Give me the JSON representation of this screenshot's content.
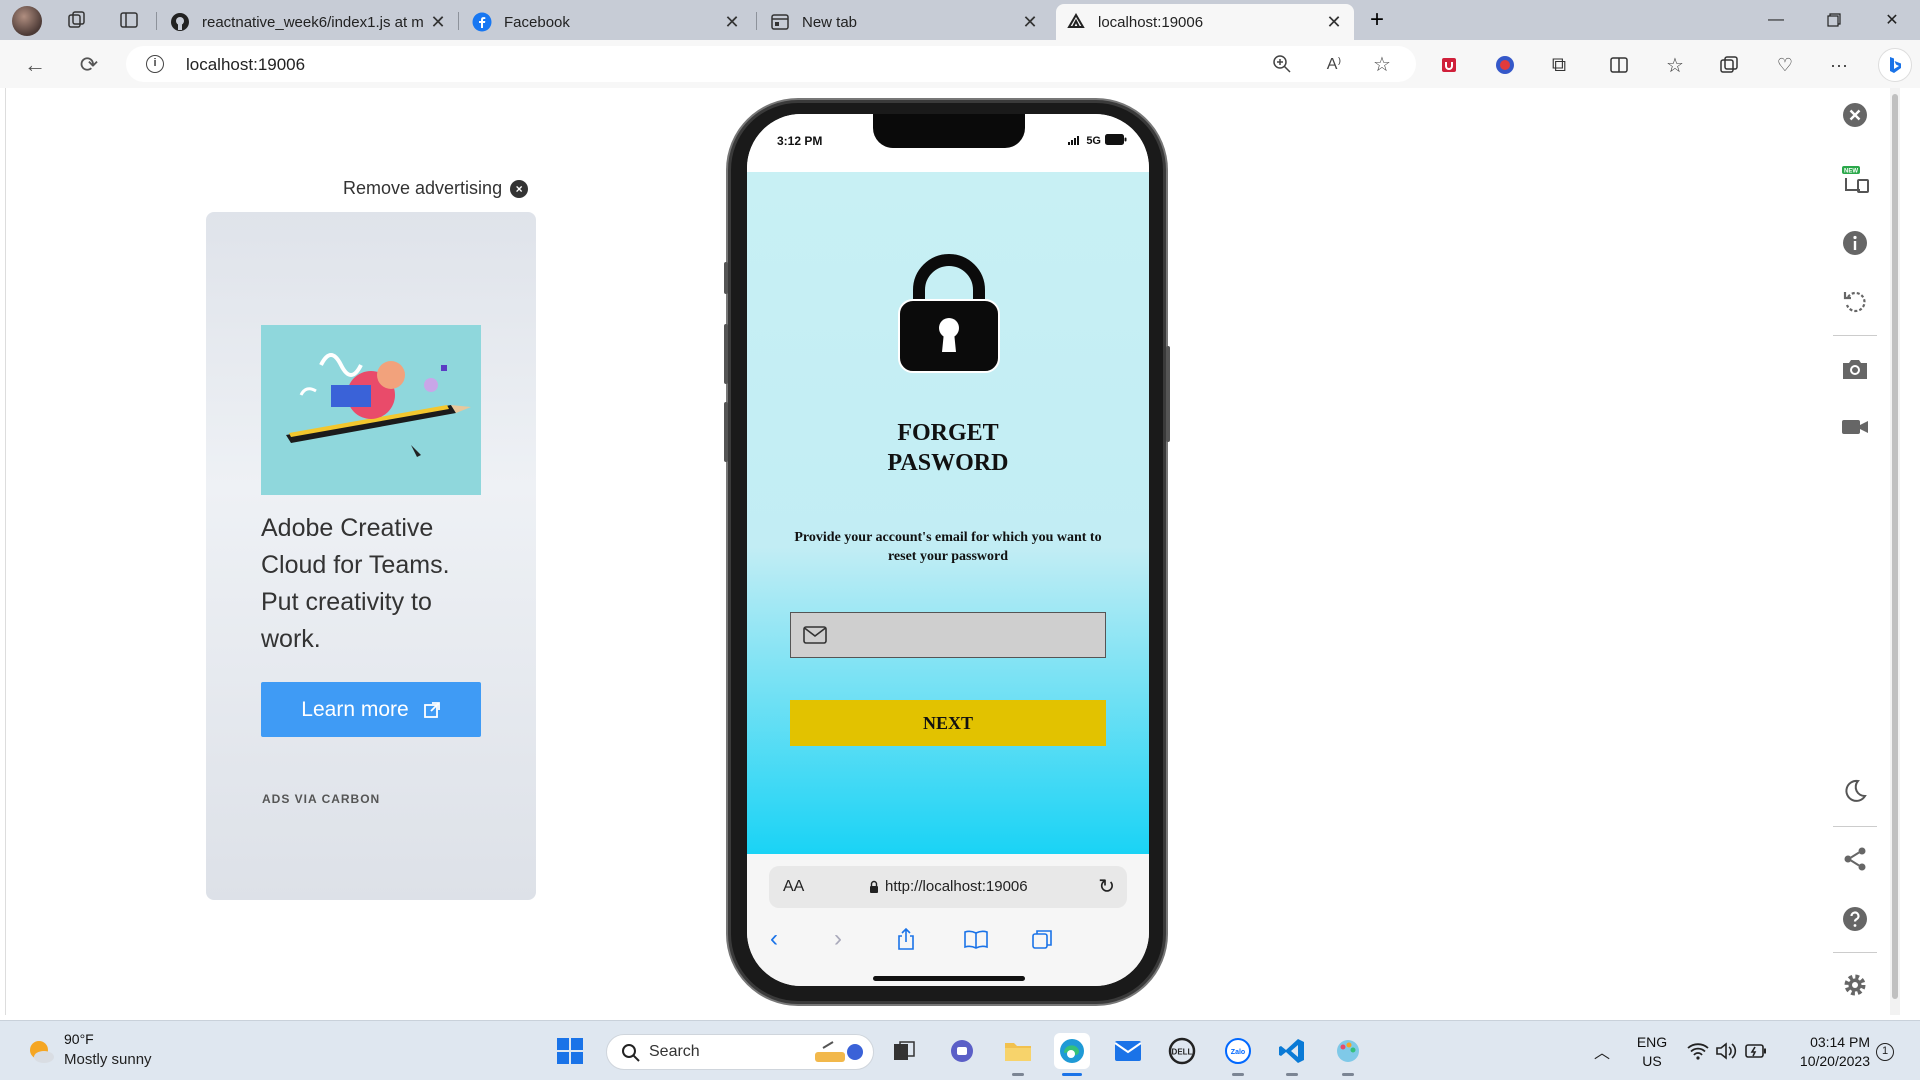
{
  "browser": {
    "tabs": [
      {
        "title": "reactnative_week6/index1.js at m",
        "icon": "github-icon"
      },
      {
        "title": "Facebook",
        "icon": "facebook-icon"
      },
      {
        "title": "New tab",
        "icon": "newtab-icon"
      },
      {
        "title": "localhost:19006",
        "icon": "expo-icon",
        "active": true
      }
    ],
    "address": "localhost:19006"
  },
  "ad": {
    "remove_label": "Remove advertising",
    "text": "Adobe Creative Cloud for Teams. Put creativity to work.",
    "button_label": "Learn more",
    "via_label": "ADS VIA CARBON"
  },
  "phone": {
    "status_time": "3:12 PM",
    "network": "5G",
    "title_line1": "FORGET",
    "title_line2": "PASWORD",
    "description": "Provide your account's email for which you want to reset your password",
    "email_value": "",
    "next_label": "NEXT",
    "safari_aa": "AA",
    "safari_url": "http://localhost:19006"
  },
  "side_panel": {
    "new_badge": "NEW",
    "tools": [
      "close-icon",
      "device-icon",
      "info-icon",
      "rotate-icon",
      "camera-icon",
      "video-icon",
      "moon-icon",
      "share-icon",
      "help-icon",
      "settings-icon"
    ]
  },
  "taskbar": {
    "weather_temp": "90°F",
    "weather_condition": "Mostly sunny",
    "search_label": "Search",
    "lang_top": "ENG",
    "lang_bottom": "US",
    "time": "03:14 PM",
    "date": "10/20/2023",
    "notification_count": "1"
  },
  "colors": {
    "ad_button": "#3f9bf5",
    "next_button": "#e2c200",
    "app_gradient_top": "#c8f0f4",
    "app_gradient_bottom": "#1ad3f5"
  }
}
